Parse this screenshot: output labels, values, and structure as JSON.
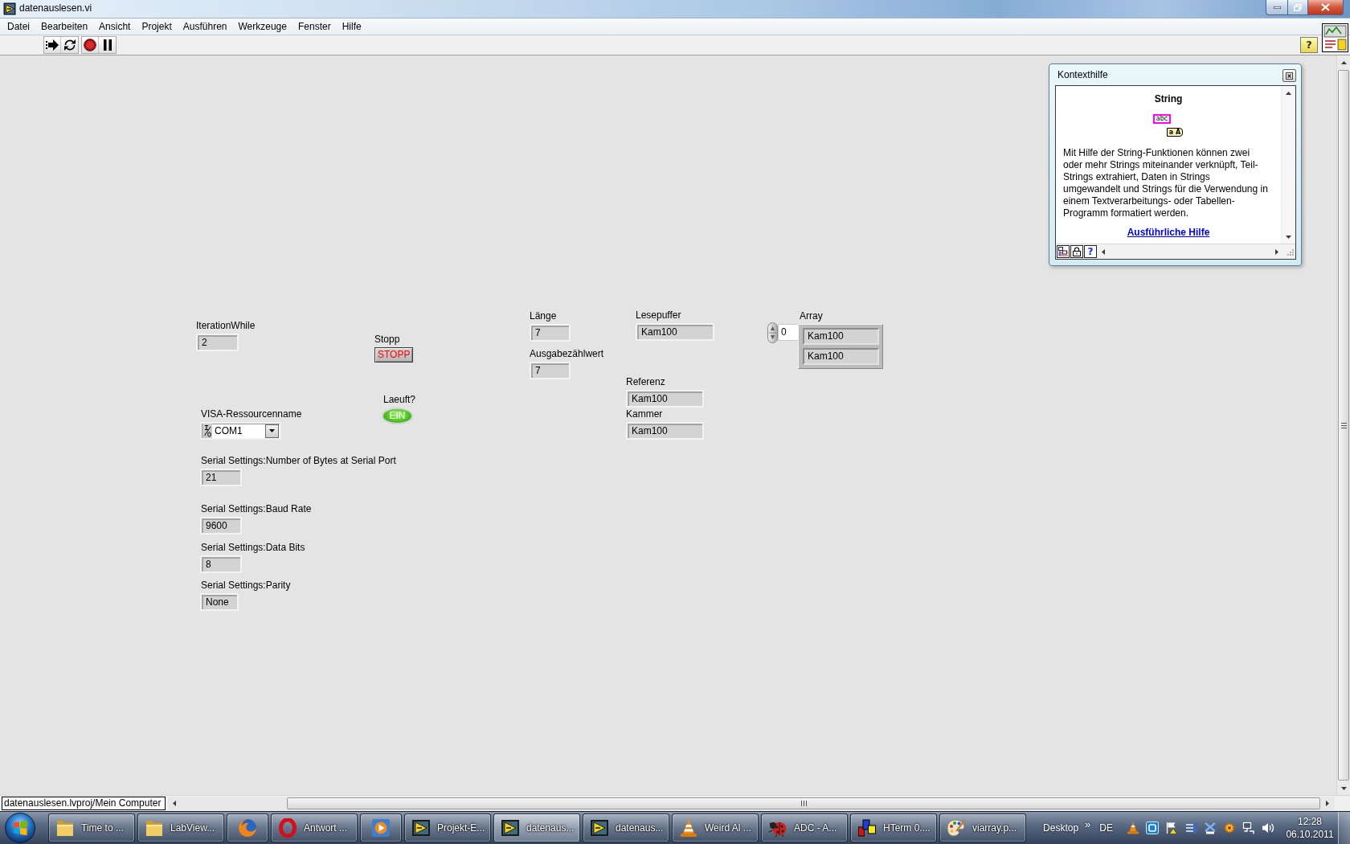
{
  "window": {
    "title": "datenauslesen.vi"
  },
  "menu": [
    {
      "label": "Datei"
    },
    {
      "label": "Bearbeiten"
    },
    {
      "label": "Ansicht"
    },
    {
      "label": "Projekt"
    },
    {
      "label": "Ausführen"
    },
    {
      "label": "Werkzeuge"
    },
    {
      "label": "Fenster"
    },
    {
      "label": "Hilfe"
    }
  ],
  "toolbar": {
    "buttons": [
      {
        "kind": "run"
      },
      {
        "kind": "run_continuously"
      },
      {
        "kind": "abort"
      },
      {
        "kind": "pause"
      }
    ],
    "help_label": "?"
  },
  "front_panel": {
    "controls": [
      {
        "kind": "numeric",
        "label": "IterationWhile",
        "value": "2"
      },
      {
        "kind": "button",
        "label": "Stopp",
        "text": "STOPP"
      },
      {
        "kind": "led",
        "label": "Laeuft?",
        "text": "EIN",
        "on": true
      },
      {
        "kind": "resource",
        "label": "VISA-Ressourcenname",
        "value": "COM1"
      },
      {
        "kind": "numeric",
        "label": "Serial Settings:Number of Bytes at Serial Port",
        "value": "21"
      },
      {
        "kind": "numeric",
        "label": "Serial Settings:Baud Rate",
        "value": "9600"
      },
      {
        "kind": "numeric",
        "label": "Serial Settings:Data Bits",
        "value": "8"
      },
      {
        "kind": "ring",
        "label": "Serial Settings:Parity",
        "value": "None"
      },
      {
        "kind": "numeric",
        "label": "Länge",
        "value": "7"
      },
      {
        "kind": "numeric",
        "label": "Ausgabezählwert",
        "value": "7"
      },
      {
        "kind": "string",
        "label": "Lesepuffer",
        "value": "Kam100"
      },
      {
        "kind": "string",
        "label": "Referenz",
        "value": "Kam100"
      },
      {
        "kind": "string",
        "label": "Kammer",
        "value": "Kam100"
      },
      {
        "kind": "array",
        "label": "Array",
        "index": "0",
        "elements": [
          "Kam100",
          "Kam100"
        ]
      }
    ]
  },
  "context_help": {
    "title": "Kontexthilfe",
    "heading": "String",
    "symbols": [
      {
        "kind": "constant",
        "text": "abc"
      },
      {
        "kind": "function",
        "text": "a A"
      }
    ],
    "description": "Mit Hilfe der String-Funktionen können zwei oder mehr Strings miteinander verknüpft, Teil-Strings extrahiert, Daten in Strings umgewandelt und Strings für die Verwendung in einem Textverarbeitungs- oder Tabellen-Programm formatiert werden.",
    "link": "Ausführliche Hilfe",
    "footer_buttons": [
      {
        "kind": "diagram"
      },
      {
        "kind": "lock"
      },
      {
        "kind": "help",
        "label": "?"
      }
    ]
  },
  "status_bar": {
    "path": "datenauslesen.lvproj/Mein Computer"
  },
  "taskbar": {
    "items": [
      {
        "kind": "folder",
        "label": "Time to ...",
        "selected": false
      },
      {
        "kind": "folder",
        "label": "LabView...",
        "selected": false
      },
      {
        "kind": "globe",
        "selected": false
      },
      {
        "kind": "ring",
        "label": "Antwort ...",
        "selected": false
      },
      {
        "kind": "play",
        "selected": false
      },
      {
        "kind": "triangle",
        "label": "Projekt-E...",
        "selected": false
      },
      {
        "kind": "triangle",
        "label": "datenaus...",
        "selected": true
      },
      {
        "kind": "triangle",
        "label": "datenaus...",
        "selected": false
      },
      {
        "kind": "cone",
        "label": "Weird Al ...",
        "selected": false
      },
      {
        "kind": "ladybug",
        "label": "ADC - A...",
        "selected": false
      },
      {
        "kind": "squares",
        "label": "HTerm 0....",
        "selected": false
      },
      {
        "kind": "palette",
        "label": "viarray.p...",
        "selected": false
      }
    ],
    "desktop": "Desktop",
    "chevron": "»",
    "language": "DE",
    "tray": [
      {
        "kind": "cone"
      },
      {
        "kind": "tile"
      },
      {
        "kind": "flag"
      },
      {
        "kind": "bars"
      },
      {
        "kind": "cross"
      },
      {
        "kind": "gear"
      },
      {
        "kind": "monitor"
      },
      {
        "kind": "speaker"
      }
    ],
    "clock": {
      "time": "12:28",
      "date": "06.10.2011"
    }
  }
}
